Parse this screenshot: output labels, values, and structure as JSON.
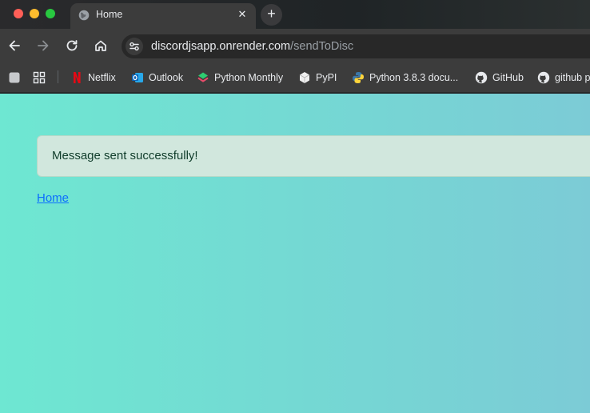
{
  "tab": {
    "title": "Home",
    "close_glyph": "✕",
    "new_tab_glyph": "+"
  },
  "toolbar": {
    "back_icon": "back-arrow-icon",
    "forward_icon": "forward-arrow-icon",
    "reload_icon": "reload-icon",
    "home_icon": "home-icon",
    "url_host": "discordjsapp.onrender.com",
    "url_path": "/sendToDisc"
  },
  "bookmarks": [
    {
      "label": "Netflix",
      "icon": "netflix-icon"
    },
    {
      "label": "Outlook",
      "icon": "outlook-icon"
    },
    {
      "label": "Python Monthly",
      "icon": "python-monthly-icon"
    },
    {
      "label": "PyPI",
      "icon": "pypi-icon"
    },
    {
      "label": "Python 3.8.3 docu...",
      "icon": "python-icon"
    },
    {
      "label": "GitHub",
      "icon": "github-icon"
    },
    {
      "label": "github p",
      "icon": "github-icon"
    }
  ],
  "page": {
    "alert_message": "Message sent successfully!",
    "home_link": "Home"
  },
  "colors": {
    "page_gradient_start": "#6ee7d2",
    "page_gradient_end": "#7ccbd6",
    "alert_bg": "#d1e7dd",
    "link": "#0d6efd"
  }
}
